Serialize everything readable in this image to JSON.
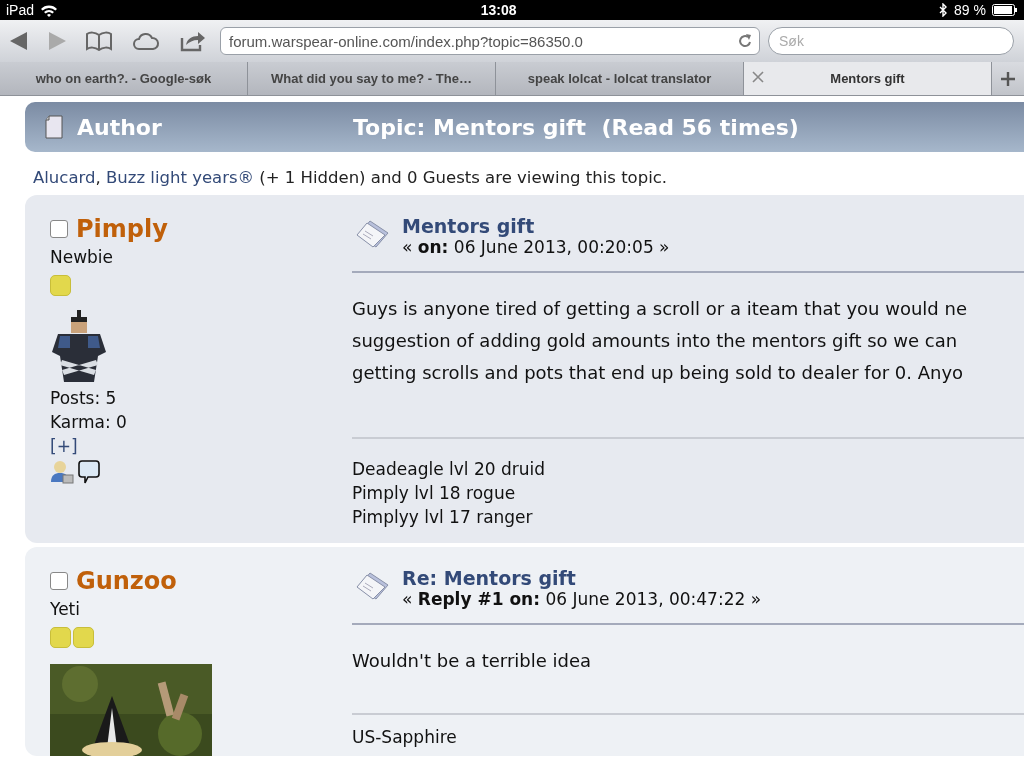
{
  "status_bar": {
    "device": "iPad",
    "time": "13:08",
    "battery": "89 %"
  },
  "toolbar": {
    "url": "forum.warspear-online.com/index.php?topic=86350.0",
    "search": {
      "placeholder": "Søk"
    }
  },
  "tabs": [
    {
      "label": "who on earth?. - Google-søk",
      "selected": false
    },
    {
      "label": "What did you say to me? - The…",
      "selected": false
    },
    {
      "label": "speak lolcat - lolcat translator",
      "selected": false
    },
    {
      "label": "Mentors gift",
      "selected": true
    }
  ],
  "header": {
    "author_label": "Author",
    "topic_title": "Topic: Mentors gift  (Read 56 times)"
  },
  "viewers": [
    {
      "kind": "link",
      "text": "Alucard"
    },
    {
      "kind": "text",
      "text": ", "
    },
    {
      "kind": "link",
      "text": "Buzz light years®"
    },
    {
      "kind": "text",
      "text": " (+ 1 Hidden) and 0 Guests are viewing this topic."
    }
  ],
  "posts": [
    {
      "author": "Pimply",
      "checked": false,
      "rank": "Newbie",
      "rank_icons": [
        {
          "kind": "pip"
        }
      ],
      "avatar": {
        "kind": "sprite"
      },
      "posts": "Posts: 5",
      "karma": "Karma: 0",
      "expand": "[+]",
      "has_profile_icons": true,
      "title": "Mentors gift",
      "meta": "« **on:** 06 June 2013, 00:20:05 »",
      "body": [
        "Guys is anyone tired of getting a scroll or a iteam that you would ne",
        "suggestion of adding gold amounts into the mentors gift so we can",
        "getting scrolls and pots that end up being sold to dealer for 0. Anyo"
      ],
      "signature": [
        "Deadeagle lvl 20 druid",
        "Pimply lvl 18 rogue",
        "Pimplyy lvl 17 ranger"
      ]
    },
    {
      "author": "Gunzoo",
      "checked": false,
      "rank": "Yeti",
      "rank_icons": [
        {
          "kind": "pip"
        },
        {
          "kind": "pip"
        }
      ],
      "avatar": {
        "kind": "picture"
      },
      "has_profile_icons": false,
      "title": "Re: Mentors gift",
      "meta": "« **Reply #1 on:** 06 June 2013, 00:47:22 »",
      "body": [
        "Wouldn't be a terrible idea"
      ],
      "signature": [
        "US-Sapphire"
      ]
    }
  ]
}
